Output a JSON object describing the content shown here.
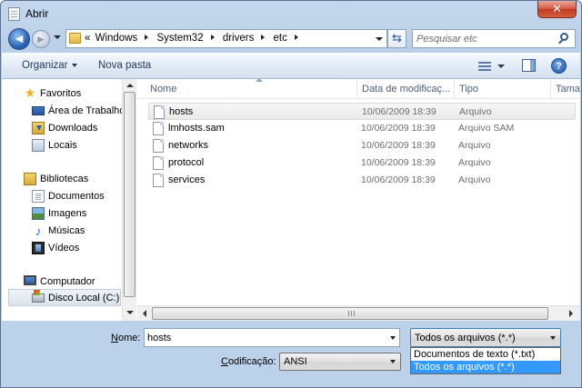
{
  "window": {
    "title": "Abrir",
    "close_label": "✕"
  },
  "address": {
    "crumbs_prefix": "«",
    "crumbs": [
      "Windows",
      "System32",
      "drivers",
      "etc"
    ]
  },
  "search": {
    "placeholder": "Pesquisar etc"
  },
  "commands": {
    "organize": "Organizar",
    "new_folder": "Nova pasta",
    "help": "?"
  },
  "nav": {
    "favorites": "Favoritos",
    "favorites_items": [
      "Área de Trabalho",
      "Downloads",
      "Locais"
    ],
    "libraries": "Bibliotecas",
    "libraries_items": [
      "Documentos",
      "Imagens",
      "Músicas",
      "Vídeos"
    ],
    "computer": "Computador",
    "computer_items": [
      "Disco Local (C:)"
    ]
  },
  "columns": {
    "name": "Nome",
    "date": "Data de modificaç...",
    "type": "Tipo",
    "size": "Tama"
  },
  "files": [
    {
      "name": "hosts",
      "date": "10/06/2009 18:39",
      "type": "Arquivo"
    },
    {
      "name": "lmhosts.sam",
      "date": "10/06/2009 18:39",
      "type": "Arquivo SAM"
    },
    {
      "name": "networks",
      "date": "10/06/2009 18:39",
      "type": "Arquivo"
    },
    {
      "name": "protocol",
      "date": "10/06/2009 18:39",
      "type": "Arquivo"
    },
    {
      "name": "services",
      "date": "10/06/2009 18:39",
      "type": "Arquivo"
    }
  ],
  "bottom": {
    "name_label_u": "N",
    "name_label_rest": "ome:",
    "name_value": "hosts",
    "filter_value": "Todos os arquivos  (*.*)",
    "filter_options": [
      "Documentos de texto (*.txt)",
      "Todos os arquivos  (*.*)"
    ],
    "encoding_label_u": "C",
    "encoding_label_rest": "odificação:",
    "encoding_value": "ANSI"
  }
}
